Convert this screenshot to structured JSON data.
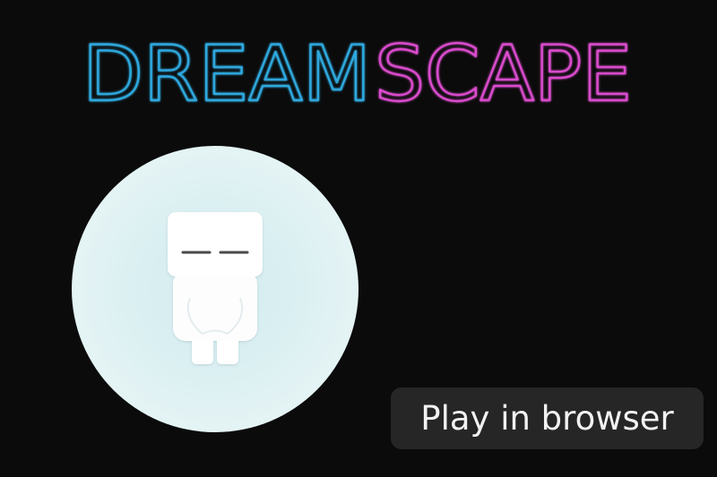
{
  "title": {
    "part1": "DREAM",
    "part2": "SCAPE",
    "color1": "#2fa8dd",
    "color2": "#d94ccc"
  },
  "play_button": {
    "label": "Play in browser"
  },
  "orb": {
    "color": "#dff1f3"
  },
  "character": {
    "icon": "sleeping-cube-character"
  }
}
